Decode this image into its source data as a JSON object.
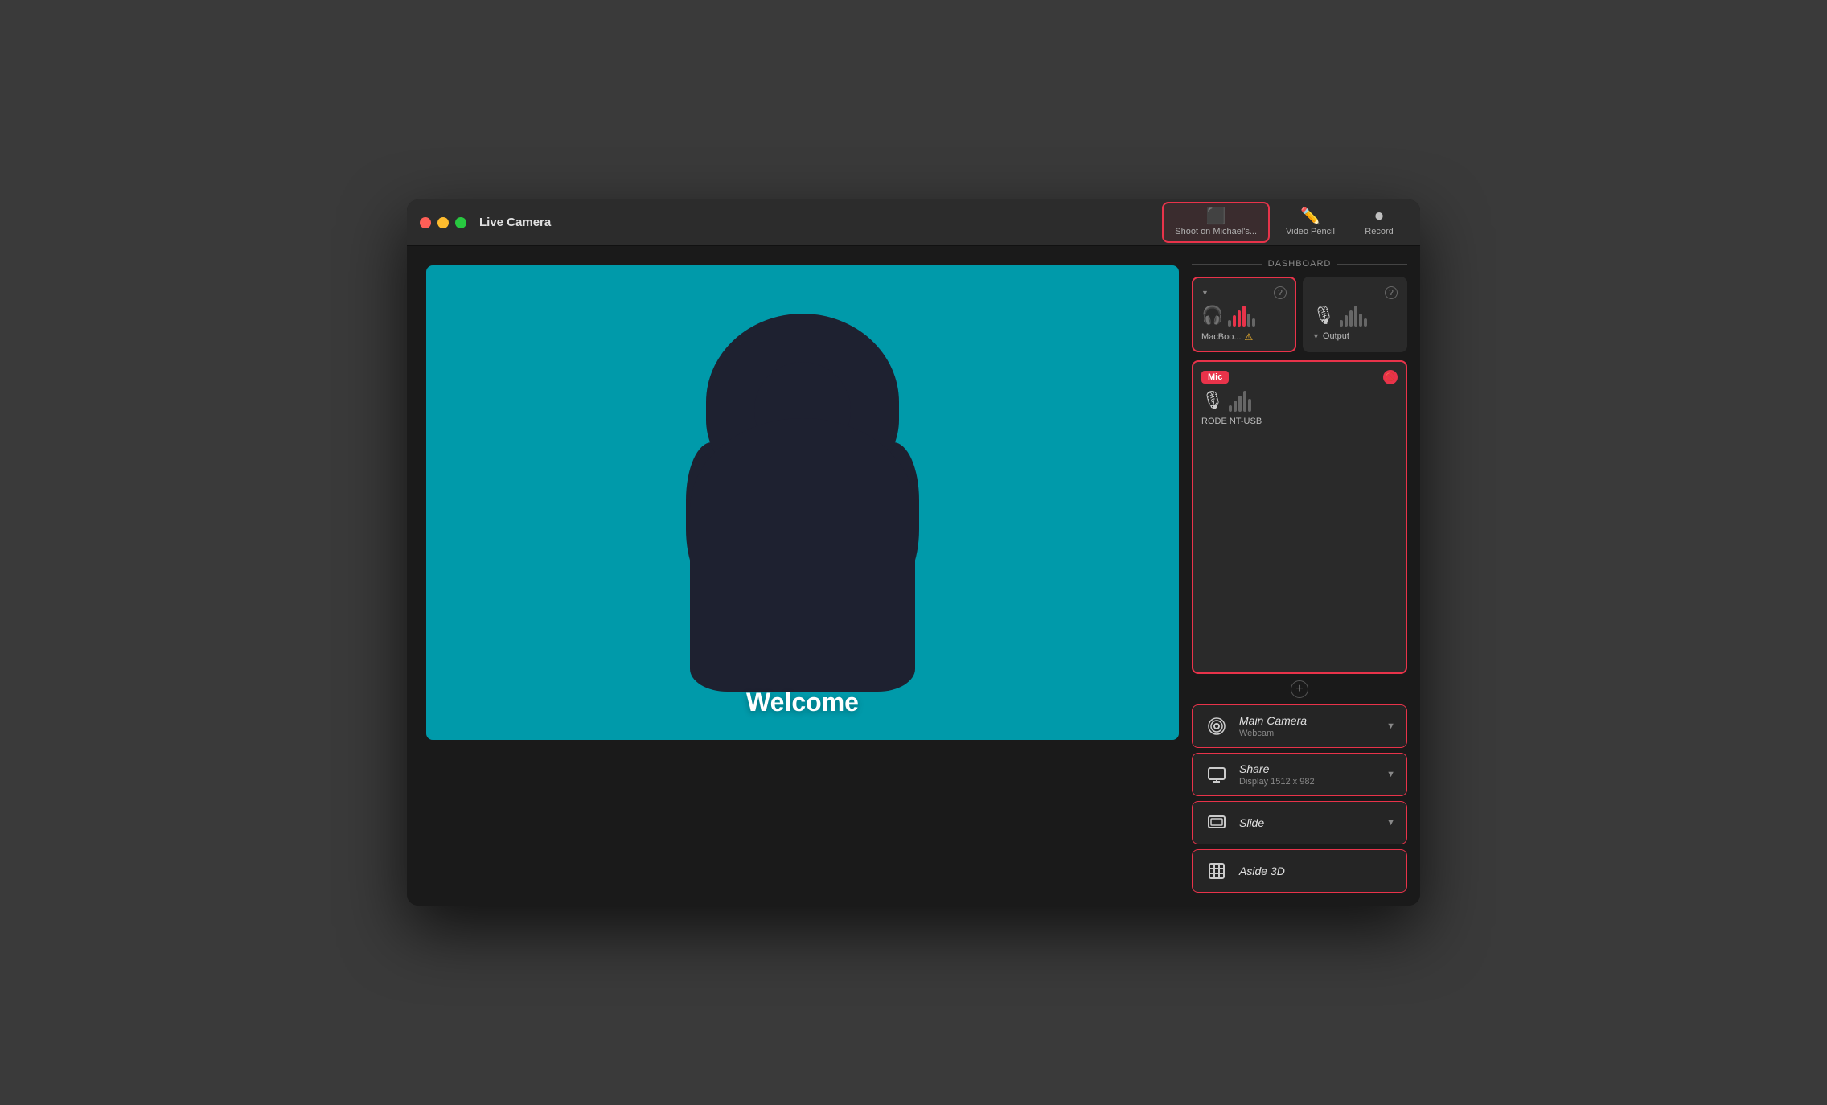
{
  "window": {
    "title": "Live Camera"
  },
  "toolbar": {
    "shoot_label": "Shoot on Michael's...",
    "video_pencil_label": "Video Pencil",
    "record_label": "Record"
  },
  "camera": {
    "welcome_text": "Welcome"
  },
  "dashboard": {
    "label": "Dashboard",
    "audio": {
      "macbook_label": "MacBoo...",
      "output_label": "Output",
      "mic_label": "Mic",
      "rode_label": "RODE NT-USB"
    },
    "sources": [
      {
        "name": "Main Camera",
        "sub": "Webcam",
        "icon": "camera"
      },
      {
        "name": "Share",
        "sub": "Display 1512 x 982",
        "icon": "share"
      },
      {
        "name": "Slide",
        "sub": "",
        "icon": "slide"
      },
      {
        "name": "Aside 3D",
        "sub": "",
        "icon": "aside3d"
      }
    ],
    "add_button": "+"
  }
}
